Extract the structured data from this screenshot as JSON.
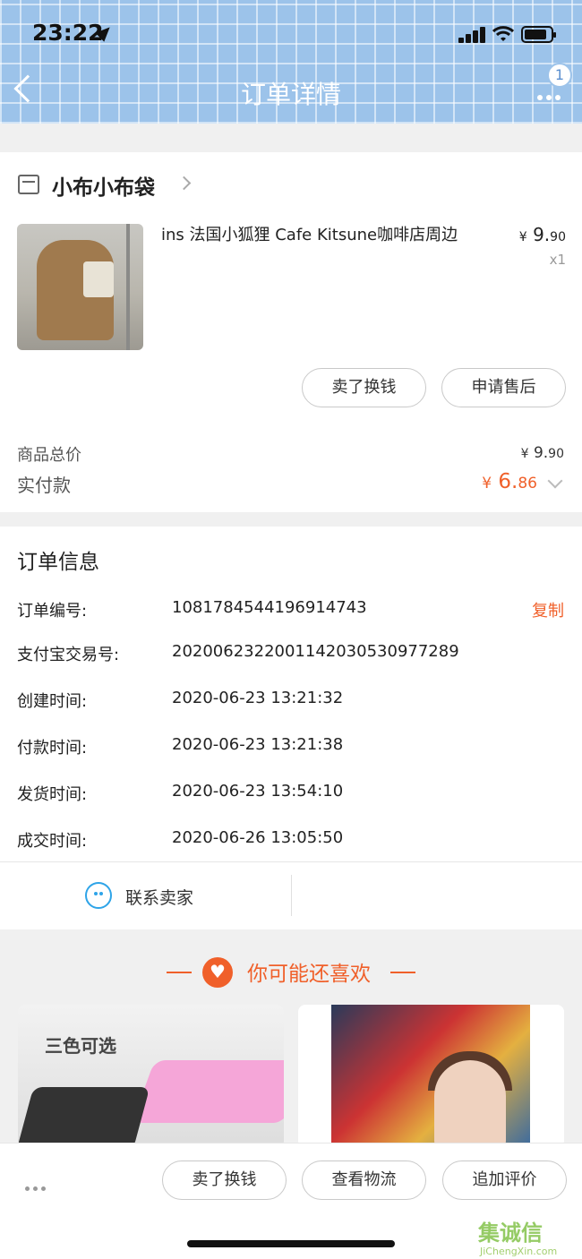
{
  "status_bar": {
    "time": "23:22"
  },
  "header": {
    "title": "订单详情",
    "badge_count": "1"
  },
  "shop": {
    "name": "小布小布袋"
  },
  "product": {
    "title": "ins 法国小狐狸 Cafe Kitsune咖啡店周边",
    "price_symbol": "¥",
    "price_int": "9.",
    "price_dec": "90",
    "quantity": "x1"
  },
  "product_actions": {
    "sell_label": "卖了换钱",
    "after_sale_label": "申请售后"
  },
  "summary": {
    "total_label": "商品总价",
    "total_symbol": "¥",
    "total_int": "9.",
    "total_dec": "90",
    "paid_label": "实付款",
    "paid_symbol": "¥",
    "paid_int": "6.",
    "paid_dec": "86"
  },
  "order_info": {
    "title": "订单信息",
    "copy_label": "复制",
    "rows": [
      {
        "label": "订单编号:",
        "value": "1081784544196914743"
      },
      {
        "label": "支付宝交易号:",
        "value": "2020062322001142030530977289"
      },
      {
        "label": "创建时间:",
        "value": "2020-06-23 13:21:32"
      },
      {
        "label": "付款时间:",
        "value": "2020-06-23 13:21:38"
      },
      {
        "label": "发货时间:",
        "value": "2020-06-23 13:54:10"
      },
      {
        "label": "成交时间:",
        "value": "2020-06-26 13:05:50"
      }
    ],
    "contact_label": "联系卖家"
  },
  "recommend": {
    "title": "你可能还喜欢",
    "items": [
      {
        "caption": "三色可选"
      },
      {
        "caption": ""
      }
    ]
  },
  "bottom_bar": {
    "sell_label": "卖了换钱",
    "logistics_label": "查看物流",
    "review_label": "追加评价"
  },
  "watermark": {
    "text": "集诚信",
    "sub": "JiChengXin.com"
  },
  "colors": {
    "accent": "#f0602a",
    "header_blue": "#9cc3ea",
    "contact_blue": "#2ea4e8"
  }
}
